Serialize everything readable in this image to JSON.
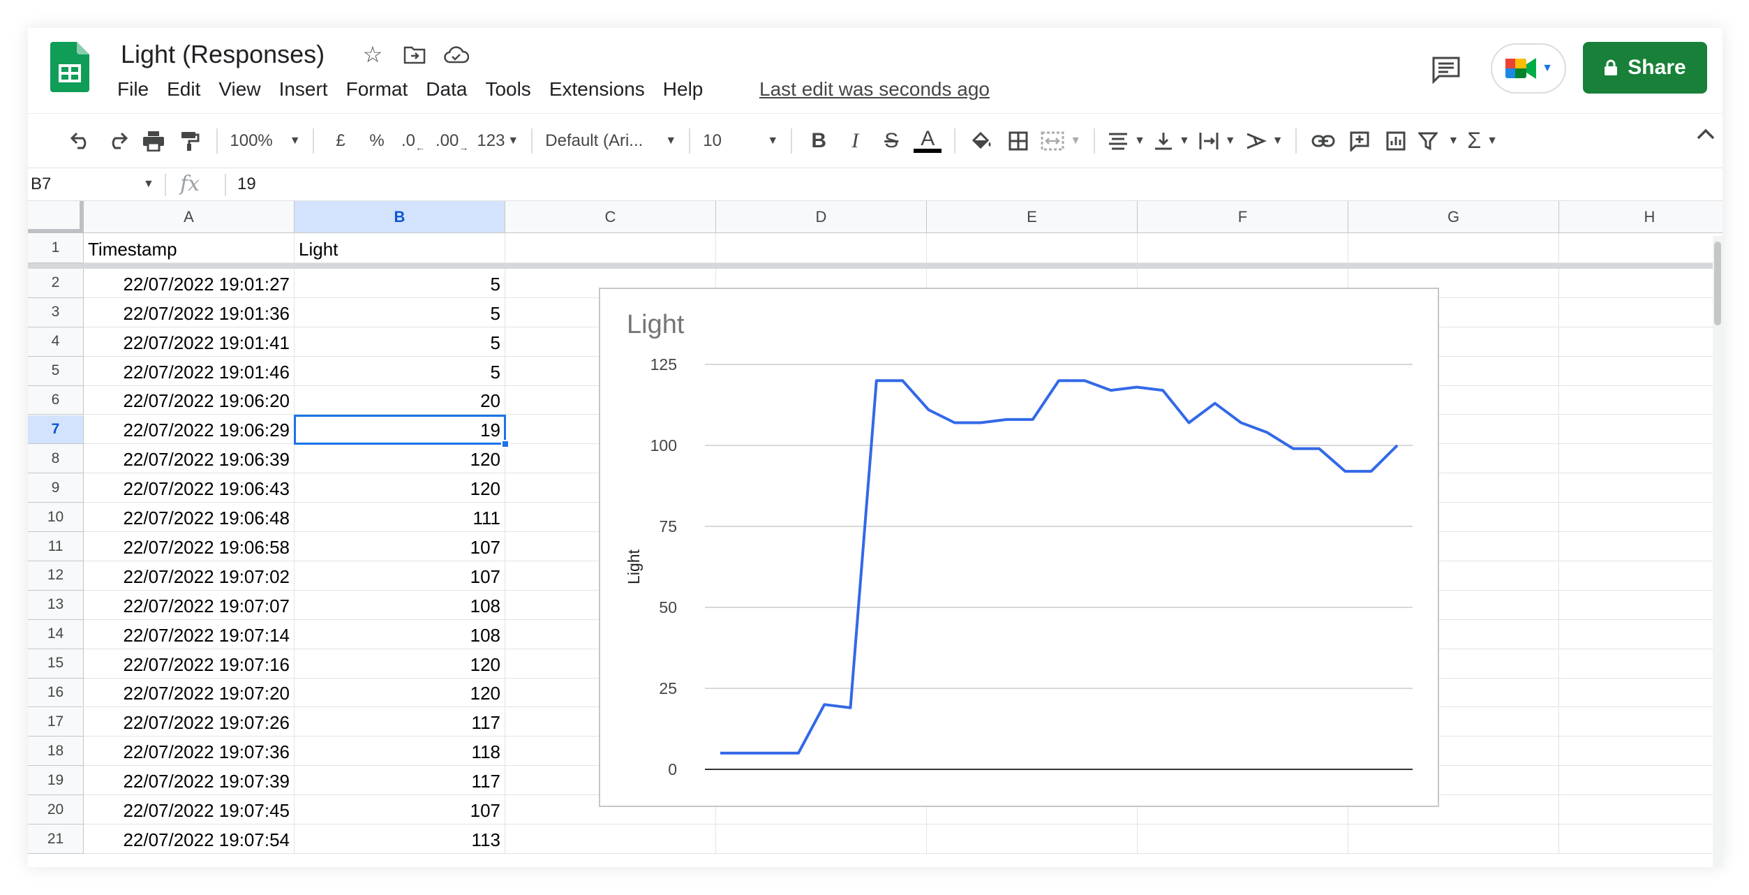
{
  "doc": {
    "title": "Light (Responses)",
    "last_edit": "Last edit was seconds ago"
  },
  "menu": [
    "File",
    "Edit",
    "View",
    "Insert",
    "Format",
    "Data",
    "Tools",
    "Extensions",
    "Help"
  ],
  "share": {
    "label": "Share"
  },
  "toolbar": {
    "zoom": "100%",
    "currency": "£",
    "percent": "%",
    "dec_decrease": ".0",
    "dec_increase": ".00",
    "more_formats": "123",
    "font": "Default (Ari...",
    "font_size": "10",
    "bold": "B",
    "italic": "I",
    "strike": "S",
    "text_color": "A"
  },
  "formula": {
    "name_box": "B7",
    "fx": "fx",
    "value": "19"
  },
  "columns": [
    "A",
    "B",
    "C",
    "D",
    "E",
    "F",
    "G",
    "H"
  ],
  "selected_column": "B",
  "selected_row": 7,
  "header_row": {
    "a": "Timestamp",
    "b": "Light"
  },
  "rows": [
    {
      "n": "1"
    },
    {
      "n": "2",
      "a": "22/07/2022 19:01:27",
      "b": "5"
    },
    {
      "n": "3",
      "a": "22/07/2022 19:01:36",
      "b": "5"
    },
    {
      "n": "4",
      "a": "22/07/2022 19:01:41",
      "b": "5"
    },
    {
      "n": "5",
      "a": "22/07/2022 19:01:46",
      "b": "5"
    },
    {
      "n": "6",
      "a": "22/07/2022 19:06:20",
      "b": "20"
    },
    {
      "n": "7",
      "a": "22/07/2022 19:06:29",
      "b": "19"
    },
    {
      "n": "8",
      "a": "22/07/2022 19:06:39",
      "b": "120"
    },
    {
      "n": "9",
      "a": "22/07/2022 19:06:43",
      "b": "120"
    },
    {
      "n": "10",
      "a": "22/07/2022 19:06:48",
      "b": "111"
    },
    {
      "n": "11",
      "a": "22/07/2022 19:06:58",
      "b": "107"
    },
    {
      "n": "12",
      "a": "22/07/2022 19:07:02",
      "b": "107"
    },
    {
      "n": "13",
      "a": "22/07/2022 19:07:07",
      "b": "108"
    },
    {
      "n": "14",
      "a": "22/07/2022 19:07:14",
      "b": "108"
    },
    {
      "n": "15",
      "a": "22/07/2022 19:07:16",
      "b": "120"
    },
    {
      "n": "16",
      "a": "22/07/2022 19:07:20",
      "b": "120"
    },
    {
      "n": "17",
      "a": "22/07/2022 19:07:26",
      "b": "117"
    },
    {
      "n": "18",
      "a": "22/07/2022 19:07:36",
      "b": "118"
    },
    {
      "n": "19",
      "a": "22/07/2022 19:07:39",
      "b": "117"
    },
    {
      "n": "20",
      "a": "22/07/2022 19:07:45",
      "b": "107"
    },
    {
      "n": "21",
      "a": "22/07/2022 19:07:54",
      "b": "113"
    }
  ],
  "colors": {
    "accent": "#1a73e8",
    "share_green": "#188038",
    "sheets_green": "#0f9d58",
    "series_line": "#3369e8",
    "gridline": "#cccccc"
  },
  "chart_data": {
    "type": "line",
    "title": "Light",
    "xlabel": "",
    "ylabel": "Light",
    "ylim": [
      0,
      125
    ],
    "yticks": [
      0,
      25,
      50,
      75,
      100,
      125
    ],
    "grid": true,
    "series": [
      {
        "values": [
          5,
          5,
          5,
          5,
          20,
          19,
          120,
          120,
          111,
          107,
          107,
          108,
          108,
          120,
          120,
          117,
          118,
          117,
          107,
          113,
          107,
          104,
          99,
          99,
          92,
          92,
          100
        ]
      }
    ]
  }
}
